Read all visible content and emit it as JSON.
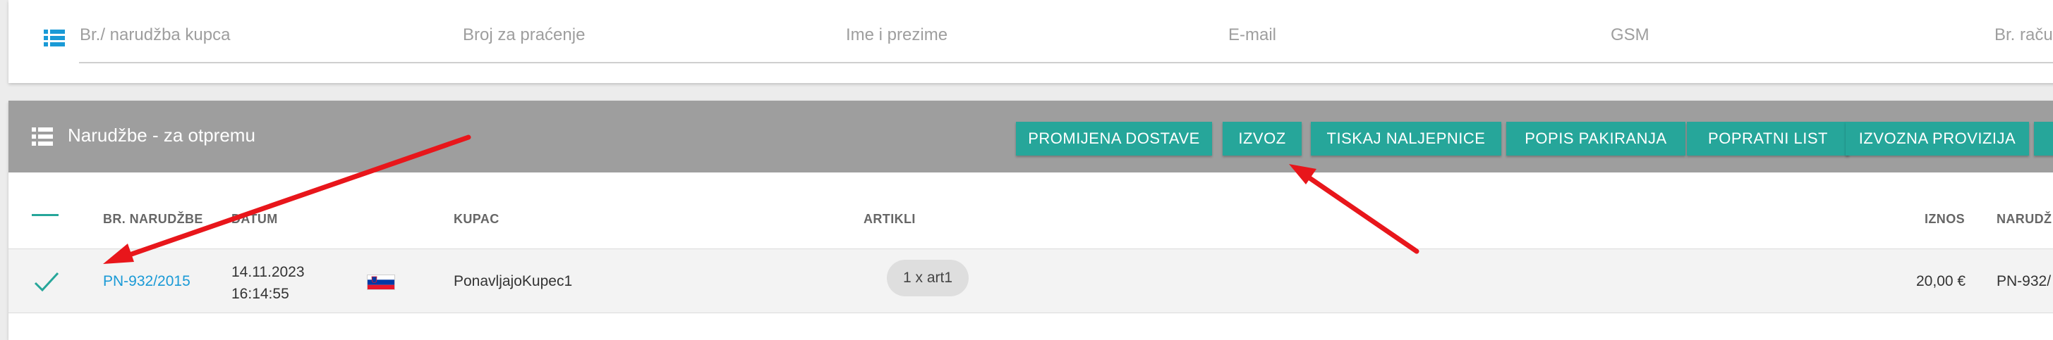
{
  "filters": {
    "icon": "list-icon",
    "fields": [
      "Br./ narudžba kupca",
      "Broj za praćenje",
      "Ime i prezime",
      "E-mail",
      "GSM",
      "Br. raču"
    ]
  },
  "orders": {
    "icon": "list-icon",
    "title": "Narudžbe - za otpremu",
    "buttons": [
      "PROMIJENA DOSTAVE",
      "IZVOZ",
      "TISKAJ NALJEPNICE",
      "POPIS PAKIRANJA",
      "POPRATNI LIST",
      "IZVOZNA PROVIZIJA",
      ""
    ],
    "columns": {
      "order_no": "BR. NARUDŽBE",
      "date": "DATUM",
      "customer": "KUPAC",
      "items": "ARTIKLI",
      "amount": "IZNOS",
      "order_extra": "NARUDŽ"
    },
    "rows": [
      {
        "selected": true,
        "order_no": "PN-932/2015",
        "date": "14.11.2023",
        "time": "16:14:55",
        "country_flag": "slovenia-flag",
        "customer": "PonavljajoKupec1",
        "items": "1 x art1",
        "amount": "20,00 €",
        "order_extra": "PN-932/"
      }
    ]
  },
  "colors": {
    "accent": "#26a69a",
    "header_bg": "#9e9e9e",
    "link": "#1a9ad6",
    "annotation": "#e8161b"
  }
}
